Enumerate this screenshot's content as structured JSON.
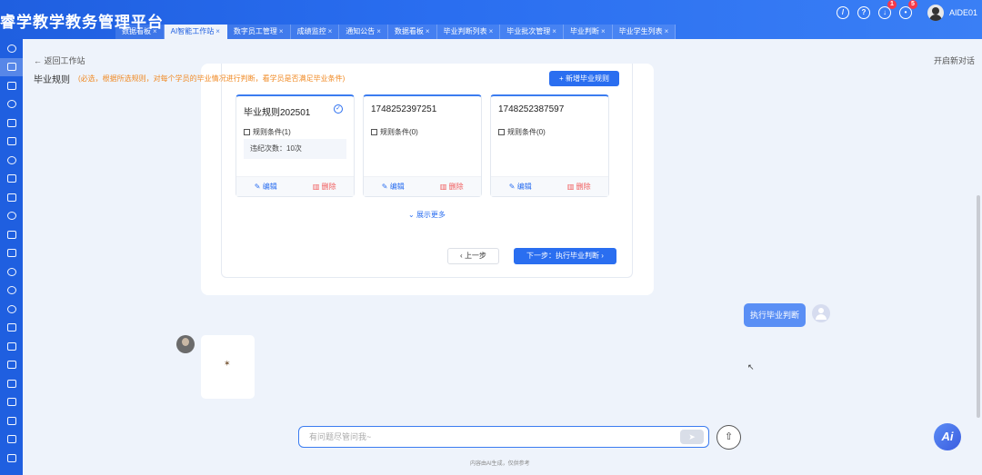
{
  "app": {
    "title": "睿学教学教务管理平台"
  },
  "tabs": [
    {
      "label": "数据看板"
    },
    {
      "label": "AI智能工作站"
    },
    {
      "label": "数字员工管理"
    },
    {
      "label": "成绩监控"
    },
    {
      "label": "通知公告"
    },
    {
      "label": "数据看板"
    },
    {
      "label": "毕业判断列表"
    },
    {
      "label": "毕业批次管理"
    },
    {
      "label": "毕业判断"
    },
    {
      "label": "毕业学生列表"
    }
  ],
  "tab_close": "×",
  "header": {
    "notification_count_1": "1",
    "notification_count_2": "5",
    "username": "AIDE01"
  },
  "nav": {
    "back": "← 返回工作站",
    "new_chat": "开启新对话"
  },
  "rules": {
    "title": "毕业规则",
    "hint": "(必选，根据所选规则，对每个学员的毕业情况进行判断，看学员是否满足毕业条件)",
    "add_button": "+ 新增毕业规则",
    "cards": [
      {
        "name": "毕业规则202501",
        "condition": "规则条件(1)",
        "detail": "违纪次数：10次",
        "selected": true
      },
      {
        "name": "1748252397251",
        "condition": "规则条件(0)",
        "detail": "",
        "selected": false
      },
      {
        "name": "1748252387597",
        "condition": "规则条件(0)",
        "detail": "",
        "selected": false
      }
    ],
    "edit_label": "编辑",
    "delete_label": "删除",
    "show_more": "展示更多",
    "prev_button": "上一步",
    "next_button": "下一步：执行毕业判断"
  },
  "chat": {
    "user_message": "执行毕业判断",
    "input_placeholder": "有问题尽管问我~",
    "disclaimer": "内容由AI生成，仅供参考"
  },
  "fab": {
    "label": "Ai"
  },
  "colors": {
    "primary": "#2a6ef0",
    "danger": "#f05a5a",
    "warning": "#f08a24"
  }
}
